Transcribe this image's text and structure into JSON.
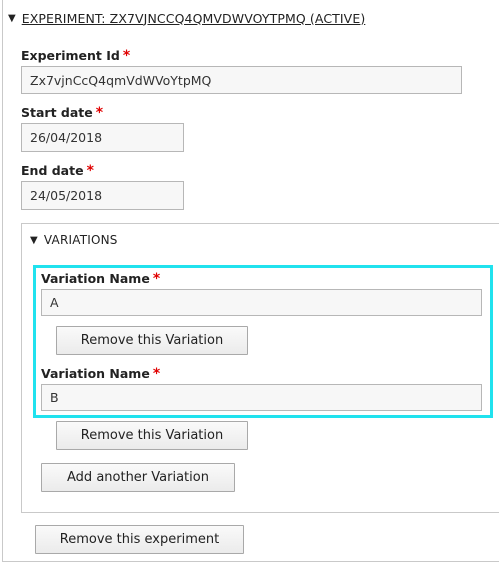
{
  "experiment": {
    "summary": "EXPERIMENT: ZX7VJNCCQ4QMVDWVOYTPMQ (ACTIVE)",
    "id_label": "Experiment Id",
    "id_value": "Zx7vjnCcQ4qmVdWVoYtpMQ",
    "start_label": "Start date",
    "start_value": "26/04/2018",
    "end_label": "End date",
    "end_value": "24/05/2018",
    "required_mark": "*",
    "remove_label": "Remove this experiment"
  },
  "variations": {
    "summary": "VARIATIONS",
    "items": [
      {
        "label": "Variation Name",
        "value": "A",
        "remove_label": "Remove this Variation"
      },
      {
        "label": "Variation Name",
        "value": "B",
        "remove_label": "Remove this Variation"
      }
    ],
    "add_label": "Add another Variation"
  },
  "icons": {
    "collapse": "triangle-down-icon"
  },
  "colors": {
    "required": "#e00000",
    "highlight": "#20e2ee",
    "border": "#c9c9c9",
    "input_bg": "#f7f7f7"
  }
}
